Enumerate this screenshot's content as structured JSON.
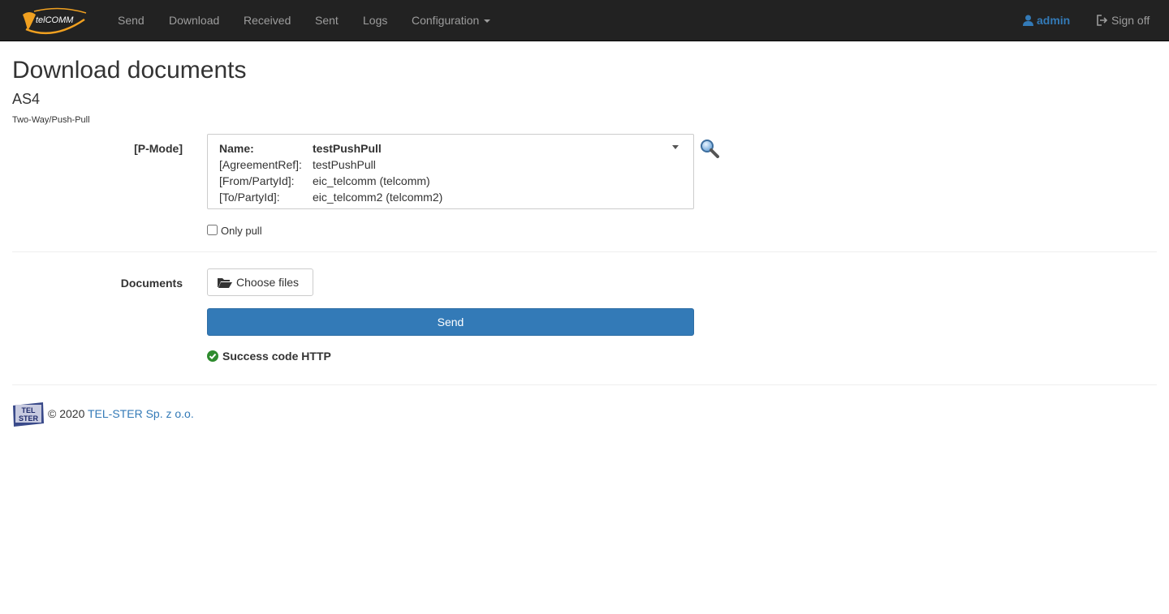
{
  "app": {
    "brand": "TelCOMM",
    "colors": {
      "navbar": "#222222",
      "accent": "#337ab7",
      "success": "#2e8b2e",
      "brand_orange": "#f0a020"
    }
  },
  "nav": {
    "items": [
      {
        "label": "Send"
      },
      {
        "label": "Download"
      },
      {
        "label": "Received"
      },
      {
        "label": "Sent"
      },
      {
        "label": "Logs"
      },
      {
        "label": "Configuration"
      }
    ],
    "user": {
      "icon": "user-icon",
      "label": "admin"
    },
    "signoff": {
      "icon": "sign-out-icon",
      "label": "Sign off"
    }
  },
  "page": {
    "title": "Download documents",
    "subtitle": "AS4",
    "mode": "Two-Way/Push-Pull"
  },
  "form": {
    "pmode_label": "[P-Mode]",
    "pmode": {
      "name_key": "Name:",
      "name_value": "testPushPull",
      "agreement_key": "[AgreementRef]:",
      "agreement_value": "testPushPull",
      "from_key": "[From/PartyId]:",
      "from_value": "eic_telcomm (telcomm)",
      "to_key": "[To/PartyId]:",
      "to_value": "eic_telcomm2 (telcomm2)"
    },
    "only_pull_label": "Only pull",
    "only_pull_checked": false,
    "documents_label": "Documents",
    "choose_files_label": "Choose files",
    "send_label": "Send",
    "status_text": "Success code HTTP"
  },
  "footer": {
    "logo_text": "TEL STER",
    "copyright": "© 2020",
    "company": "TEL-STER Sp. z o.o."
  }
}
